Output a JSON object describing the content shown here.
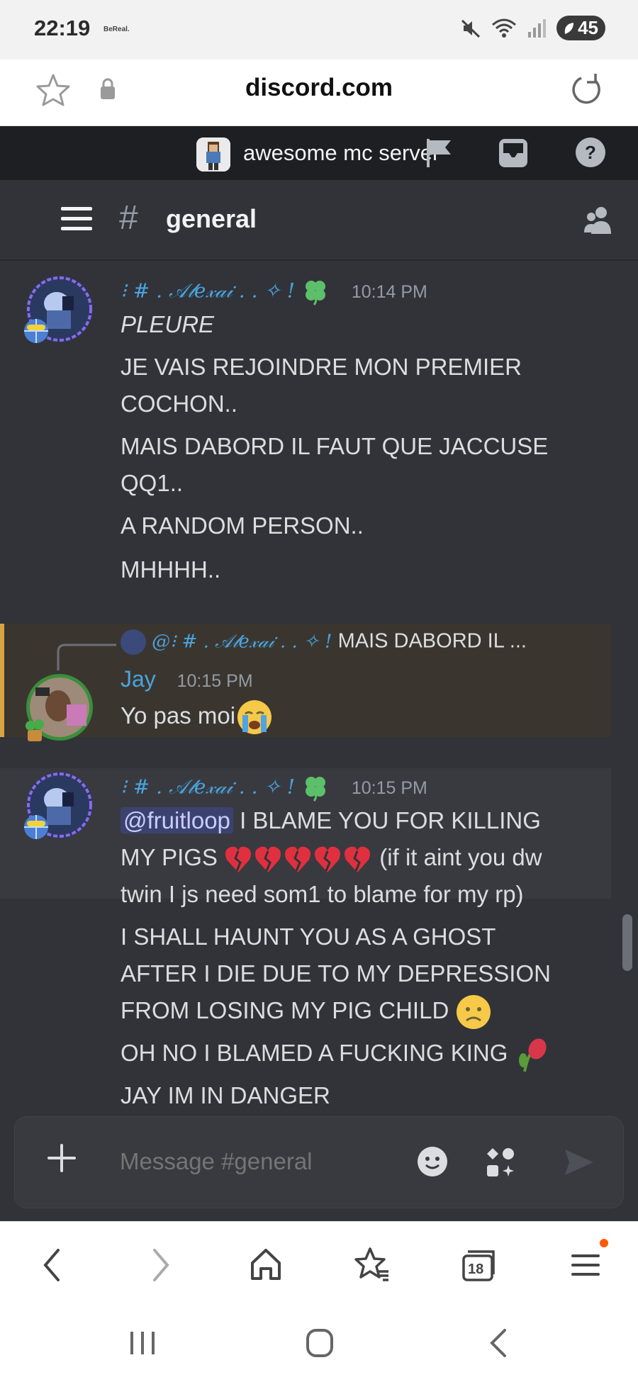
{
  "status_bar": {
    "time": "22:19",
    "app_notification": "BeReal.",
    "battery": "45"
  },
  "browser": {
    "url": "discord.com",
    "tab_count": "18"
  },
  "server": {
    "name": "awesome mc server"
  },
  "channel": {
    "name": "general",
    "hash": "#"
  },
  "messages": [
    {
      "author": "⁝ # . 𝒜𝓁𝑒𝓍𝒶𝒾 . . ✧ !",
      "time": "10:14 PM",
      "lines": [
        "PLEURE",
        "JE VAIS REJOINDRE MON PREMIER",
        "COCHON..",
        "MAIS DABORD IL FAUT QUE JACCUSE",
        "QQ1..",
        "A RANDOM PERSON..",
        "MHHHH.."
      ]
    },
    {
      "reply_prefix": "@⁝ # . 𝒜𝓁𝑒𝓍𝒶𝒾 . . ✧ !",
      "reply_preview": "MAIS DABORD IL ...",
      "author": "Jay",
      "time": "10:15 PM",
      "text": "Yo pas moi"
    },
    {
      "author": "⁝ # . 𝒜𝓁𝑒𝓍𝒶𝒾 . . ✧ !",
      "time": "10:15 PM",
      "mention": "@fruitloop",
      "line1_rest": "I BLAME YOU FOR KILLING",
      "line2_start": "MY PIGS",
      "line2_end": "(if it aint you dw",
      "line3": "twin I js need som1 to blame for my rp)",
      "line4": "I SHALL HAUNT YOU AS A GHOST",
      "line5": "AFTER I DIE DUE TO MY DEPRESSION",
      "line6": "FROM LOSING MY PIG CHILD",
      "line7": "OH NO I BLAMED A FUCKING KING",
      "line8": "JAY IM IN DANGER"
    }
  ],
  "composer": {
    "placeholder": "Message #general"
  },
  "colors": {
    "discord_bg": "#313338",
    "discord_dark": "#1e1f22",
    "username_blue": "#4aa3df",
    "reply_highlight": "#d9a344",
    "mention_bg": "#3c4270"
  }
}
